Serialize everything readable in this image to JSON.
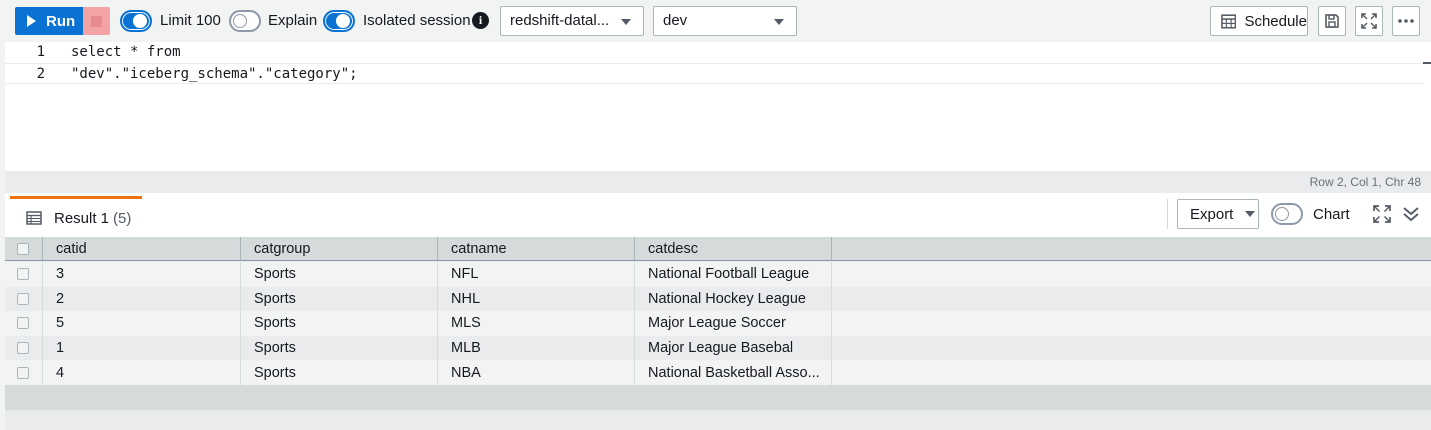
{
  "toolbar": {
    "run_label": "Run",
    "limit_label": "Limit 100",
    "explain_label": "Explain",
    "isolated_label": "Isolated session",
    "connection_select": "redshift-datal...",
    "database_select": "dev",
    "schedule_label": "Schedule",
    "toggles": {
      "limit": true,
      "explain": false,
      "isolated": true
    }
  },
  "editor": {
    "lines": [
      {
        "num": "1",
        "keyword": "select * from",
        "rest": ""
      },
      {
        "num": "2",
        "keyword": "",
        "rest": "\"dev\".\"iceberg_schema\".\"category\";"
      }
    ],
    "status": "Row 2,  Col 1,  Chr 48"
  },
  "results": {
    "tab_label": "Result 1",
    "tab_count": "(5)",
    "export_label": "Export",
    "chart_label": "Chart",
    "chart_toggle_on": false,
    "columns": [
      "catid",
      "catgroup",
      "catname",
      "catdesc"
    ],
    "rows": [
      [
        "3",
        "Sports",
        "NFL",
        "National Football League"
      ],
      [
        "2",
        "Sports",
        "NHL",
        "National Hockey League"
      ],
      [
        "5",
        "Sports",
        "MLS",
        "Major League Soccer"
      ],
      [
        "1",
        "Sports",
        "MLB",
        "Major League Basebal"
      ],
      [
        "4",
        "Sports",
        "NBA",
        "National Basketball Asso..."
      ]
    ]
  },
  "colors": {
    "primary": "#0972d3",
    "tab_accent": "#ec7211",
    "stop": "#f3a3a6"
  },
  "icons": [
    "play-icon",
    "stop-icon",
    "info-icon",
    "calendar-icon",
    "save-icon",
    "fullscreen-icon",
    "more-icon",
    "table-icon",
    "expand-icon",
    "collapse-icon"
  ]
}
